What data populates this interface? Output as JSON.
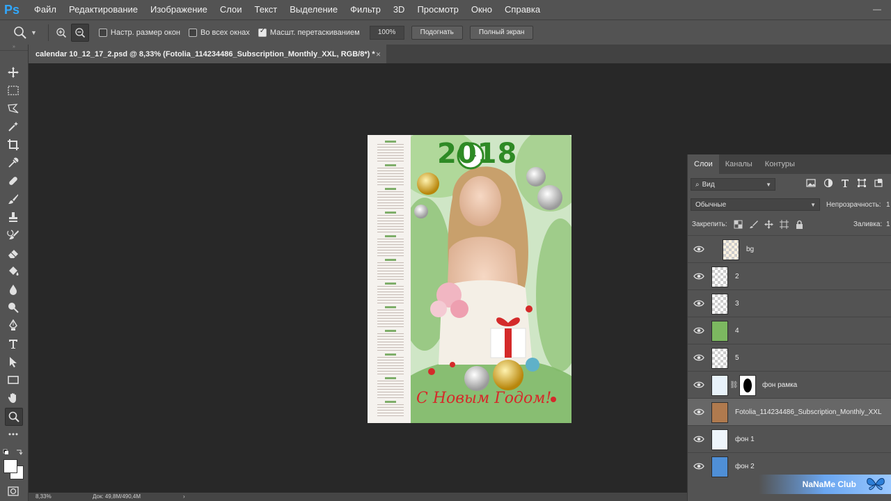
{
  "app": {
    "logo": "Ps"
  },
  "menu": [
    "Файл",
    "Редактирование",
    "Изображение",
    "Слои",
    "Текст",
    "Выделение",
    "Фильтр",
    "3D",
    "Просмотр",
    "Окно",
    "Справка"
  ],
  "options": {
    "resize_windows": "Настр. размер окон",
    "all_windows": "Во всех окнах",
    "scrubby_zoom": "Масшт. перетаскиванием",
    "zoom_value": "100%",
    "fit_button": "Подогнать",
    "fill_screen_button": "Полный экран",
    "resize_windows_checked": false,
    "all_windows_checked": false,
    "scrubby_zoom_checked": true
  },
  "document": {
    "tab_title": "calendar 10_12_17_2.psd @ 8,33% (Fotolia_114234486_Subscription_Monthly_XXL, RGB/8*) *",
    "year_text": "2018",
    "greeting_text": "С Новым Годом!"
  },
  "tools": [
    "move-tool",
    "marquee-tool",
    "lasso-tool",
    "magic-wand-tool",
    "crop-tool",
    "eyedropper-tool",
    "healing-brush-tool",
    "brush-tool",
    "clone-stamp-tool",
    "history-brush-tool",
    "eraser-tool",
    "paint-bucket-tool",
    "blur-tool",
    "dodge-tool",
    "pen-tool",
    "type-tool",
    "path-selection-tool",
    "rectangle-tool",
    "hand-tool",
    "zoom-tool",
    "more-tools"
  ],
  "layers_panel": {
    "tabs": [
      "Слои",
      "Каналы",
      "Контуры"
    ],
    "filter_label": "Вид",
    "blend_mode": "Обычные",
    "opacity_label": "Непрозрачность:",
    "opacity_value": "1",
    "lock_label": "Закрепить:",
    "fill_label": "Заливка:",
    "fill_value": "1",
    "layers": [
      {
        "name": "bg",
        "selected": false
      },
      {
        "name": "2",
        "selected": false
      },
      {
        "name": "3",
        "selected": false
      },
      {
        "name": "4",
        "selected": false
      },
      {
        "name": "5",
        "selected": false
      },
      {
        "name": "фон рамка",
        "selected": false
      },
      {
        "name": "Fotolia_114234486_Subscription_Monthly_XXL",
        "selected": true
      },
      {
        "name": "фон 1",
        "selected": false
      },
      {
        "name": "фон 2",
        "selected": false
      }
    ]
  },
  "status": {
    "zoom": "8,33%",
    "doc_info": "Док: 49,8M/490,4M"
  },
  "watermark": "NaNaMe Club",
  "colors": {
    "app_bg": "#535353",
    "canvas_bg": "#282828",
    "accent": "#31a8ff"
  }
}
